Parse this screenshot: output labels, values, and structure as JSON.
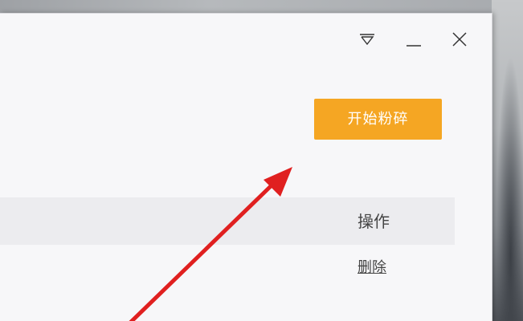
{
  "window": {
    "controls": {
      "menu_icon": "triangle-down-icon",
      "minimize_icon": "minimize-icon",
      "close_icon": "close-icon"
    }
  },
  "toolbar": {
    "start_shred_label": "开始粉碎",
    "accent_color": "#f5a623"
  },
  "table": {
    "columns": [
      "操作"
    ],
    "rows": [
      {
        "action": "删除"
      }
    ]
  },
  "annotation": {
    "type": "arrow",
    "color": "#e02020"
  }
}
